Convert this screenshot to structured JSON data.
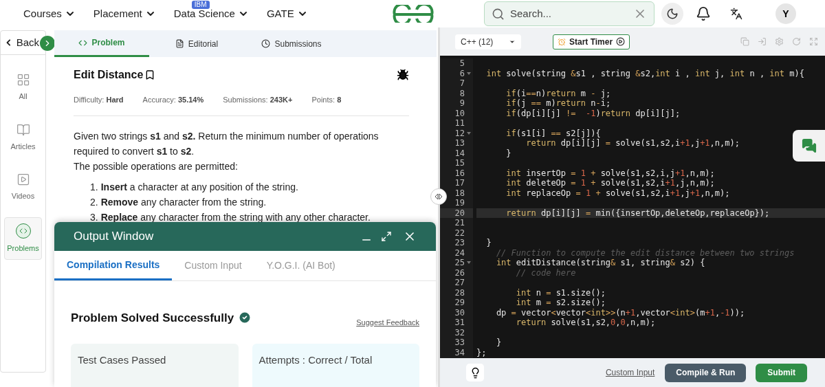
{
  "top_nav": {
    "items": [
      {
        "label": "Courses"
      },
      {
        "label": "Placement"
      },
      {
        "label": "Data Science",
        "badge": "IBM"
      },
      {
        "label": "GATE"
      }
    ],
    "search": {
      "placeholder": "Search..."
    },
    "avatar": "Y"
  },
  "sidebar": {
    "back": "Back",
    "items": [
      {
        "label": "All",
        "selected": false
      },
      {
        "label": "Articles",
        "selected": false
      },
      {
        "label": "Videos",
        "selected": false
      },
      {
        "label": "Problems",
        "selected": true
      }
    ]
  },
  "problem_tabs": [
    {
      "label": "Problem",
      "selected": true
    },
    {
      "label": "Editorial",
      "selected": false
    },
    {
      "label": "Submissions",
      "selected": false
    }
  ],
  "problem": {
    "title": "Edit Distance",
    "meta": [
      {
        "label": "Difficulty:",
        "value": "Hard"
      },
      {
        "label": "Accuracy:",
        "value": "35.14%"
      },
      {
        "label": "Submissions:",
        "value": "243K+"
      },
      {
        "label": "Points:",
        "value": "8"
      }
    ],
    "paragraphs": [
      "Given two strings **s1** and **s2.** Return the minimum number of operations required to convert **s1** to **s2**.",
      "The possible operations are permitted:"
    ],
    "operations": [
      {
        "number": "1.",
        "text": "**Insert** a character at any position of the string."
      },
      {
        "number": "2.",
        "text": "**Remove** any character from the string."
      },
      {
        "number": "3.",
        "text": "**Replace** any character from the string with any other character."
      }
    ]
  },
  "output_window": {
    "title": "Output Window",
    "tabs": [
      {
        "label": "Compilation Results",
        "selected": true
      },
      {
        "label": "Custom Input",
        "selected": false
      },
      {
        "label": "Y.O.G.I. (AI Bot)",
        "selected": false
      }
    ],
    "result": "Problem Solved Successfully",
    "feedback_link": "Suggest Feedback",
    "cards": [
      {
        "label": "Test Cases Passed"
      },
      {
        "label": "Attempts : Correct / Total"
      }
    ]
  },
  "editor": {
    "language": "C++ (12)",
    "timer_button": "Start Timer",
    "lines": [
      {
        "number": "5",
        "active": false,
        "fold": false
      },
      {
        "number": "6",
        "active": false,
        "fold": true,
        "tokens": [
          {
            "kind": "keyword",
            "text": "  int"
          },
          {
            "kind": "plain",
            "text": " solve(string "
          },
          {
            "kind": "op",
            "text": "&"
          },
          {
            "kind": "plain",
            "text": "s1 , string "
          },
          {
            "kind": "op",
            "text": "&"
          },
          {
            "kind": "plain",
            "text": "s2,"
          },
          {
            "kind": "keyword",
            "text": "int"
          },
          {
            "kind": "plain",
            "text": " i , "
          },
          {
            "kind": "keyword",
            "text": "int"
          },
          {
            "kind": "plain",
            "text": " j, "
          },
          {
            "kind": "keyword",
            "text": "int"
          },
          {
            "kind": "plain",
            "text": " n , "
          },
          {
            "kind": "keyword",
            "text": "int"
          },
          {
            "kind": "plain",
            "text": " m){"
          }
        ]
      },
      {
        "number": "7",
        "active": false,
        "fold": false
      },
      {
        "number": "8",
        "active": false,
        "fold": false,
        "tokens": [
          {
            "kind": "keyword",
            "text": "      if"
          },
          {
            "kind": "plain",
            "text": "(i"
          },
          {
            "kind": "op",
            "text": "=="
          },
          {
            "kind": "plain",
            "text": "n)"
          },
          {
            "kind": "keyword",
            "text": "return"
          },
          {
            "kind": "plain",
            "text": " m "
          },
          {
            "kind": "op",
            "text": "-"
          },
          {
            "kind": "plain",
            "text": " j;"
          }
        ]
      },
      {
        "number": "9",
        "active": false,
        "fold": false,
        "tokens": [
          {
            "kind": "keyword",
            "text": "      if"
          },
          {
            "kind": "plain",
            "text": "(j "
          },
          {
            "kind": "op",
            "text": "=="
          },
          {
            "kind": "plain",
            "text": " m)"
          },
          {
            "kind": "keyword",
            "text": "return"
          },
          {
            "kind": "plain",
            "text": " n"
          },
          {
            "kind": "op",
            "text": "-"
          },
          {
            "kind": "plain",
            "text": "i;"
          }
        ]
      },
      {
        "number": "10",
        "active": false,
        "fold": false,
        "tokens": [
          {
            "kind": "keyword",
            "text": "      if"
          },
          {
            "kind": "plain",
            "text": "(dp[i][j] "
          },
          {
            "kind": "op",
            "text": "!="
          },
          {
            "kind": "num",
            "text": "  -1"
          },
          {
            "kind": "plain",
            "text": ")"
          },
          {
            "kind": "keyword",
            "text": "return"
          },
          {
            "kind": "plain",
            "text": " dp[i][j];"
          }
        ]
      },
      {
        "number": "11",
        "active": false,
        "fold": false
      },
      {
        "number": "12",
        "active": false,
        "fold": true,
        "tokens": [
          {
            "kind": "keyword",
            "text": "      if"
          },
          {
            "kind": "plain",
            "text": "(s1[i] "
          },
          {
            "kind": "op",
            "text": "=="
          },
          {
            "kind": "plain",
            "text": " s2[j]){"
          }
        ]
      },
      {
        "number": "13",
        "active": false,
        "fold": false,
        "tokens": [
          {
            "kind": "keyword",
            "text": "          return"
          },
          {
            "kind": "plain",
            "text": " dp[i][j] "
          },
          {
            "kind": "op",
            "text": "="
          },
          {
            "kind": "plain",
            "text": " solve(s1,s2,i"
          },
          {
            "kind": "num",
            "text": "+1"
          },
          {
            "kind": "plain",
            "text": ",j"
          },
          {
            "kind": "num",
            "text": "+1"
          },
          {
            "kind": "plain",
            "text": ",n,m);"
          }
        ]
      },
      {
        "number": "14",
        "active": false,
        "fold": false,
        "tokens": [
          {
            "kind": "plain",
            "text": "      }"
          }
        ]
      },
      {
        "number": "15",
        "active": false,
        "fold": false
      },
      {
        "number": "16",
        "active": false,
        "fold": false,
        "tokens": [
          {
            "kind": "keyword",
            "text": "      int"
          },
          {
            "kind": "plain",
            "text": " insertOp "
          },
          {
            "kind": "op",
            "text": "="
          },
          {
            "kind": "num",
            "text": " 1"
          },
          {
            "kind": "op",
            "text": " +"
          },
          {
            "kind": "plain",
            "text": " solve(s1,s2,i,j"
          },
          {
            "kind": "num",
            "text": "+1"
          },
          {
            "kind": "plain",
            "text": ",n,m);"
          }
        ]
      },
      {
        "number": "17",
        "active": false,
        "fold": false,
        "tokens": [
          {
            "kind": "keyword",
            "text": "      int"
          },
          {
            "kind": "plain",
            "text": " deleteOp "
          },
          {
            "kind": "op",
            "text": "="
          },
          {
            "kind": "num",
            "text": " 1"
          },
          {
            "kind": "op",
            "text": " +"
          },
          {
            "kind": "plain",
            "text": " solve(s1,s2,i"
          },
          {
            "kind": "num",
            "text": "+1"
          },
          {
            "kind": "plain",
            "text": ",j,n,m);"
          }
        ]
      },
      {
        "number": "18",
        "active": false,
        "fold": false,
        "tokens": [
          {
            "kind": "keyword",
            "text": "      int"
          },
          {
            "kind": "plain",
            "text": " replaceOp "
          },
          {
            "kind": "op",
            "text": "="
          },
          {
            "kind": "num",
            "text": " 1"
          },
          {
            "kind": "op",
            "text": " +"
          },
          {
            "kind": "plain",
            "text": " solve(s1,s2,i"
          },
          {
            "kind": "num",
            "text": "+1"
          },
          {
            "kind": "plain",
            "text": ",j"
          },
          {
            "kind": "num",
            "text": "+1"
          },
          {
            "kind": "plain",
            "text": ",n,m);"
          }
        ]
      },
      {
        "number": "19",
        "active": false,
        "fold": false
      },
      {
        "number": "20",
        "active": true,
        "fold": false,
        "tokens": [
          {
            "kind": "keyword",
            "text": "      return"
          },
          {
            "kind": "plain",
            "text": " dp[i][j] "
          },
          {
            "kind": "op",
            "text": "="
          },
          {
            "kind": "plain",
            "text": " min({insertOp,deleteOp,replaceOp});"
          }
        ]
      },
      {
        "number": "21",
        "active": false,
        "fold": false
      },
      {
        "number": "22",
        "active": false,
        "fold": false
      },
      {
        "number": "23",
        "active": false,
        "fold": false,
        "tokens": [
          {
            "kind": "plain",
            "text": "  }"
          }
        ]
      },
      {
        "number": "24",
        "active": false,
        "fold": false,
        "tokens": [
          {
            "kind": "comment",
            "text": "    // Function to compute the edit distance between two strings"
          }
        ]
      },
      {
        "number": "25",
        "active": false,
        "fold": true,
        "tokens": [
          {
            "kind": "keyword",
            "text": "    int"
          },
          {
            "kind": "plain",
            "text": " editDistance(string"
          },
          {
            "kind": "op",
            "text": "&"
          },
          {
            "kind": "plain",
            "text": " s1, string"
          },
          {
            "kind": "op",
            "text": "&"
          },
          {
            "kind": "plain",
            "text": " s2) {"
          }
        ]
      },
      {
        "number": "26",
        "active": false,
        "fold": false,
        "tokens": [
          {
            "kind": "comment",
            "text": "        // code here"
          }
        ]
      },
      {
        "number": "27",
        "active": false,
        "fold": false
      },
      {
        "number": "28",
        "active": false,
        "fold": false,
        "tokens": [
          {
            "kind": "keyword",
            "text": "        int"
          },
          {
            "kind": "plain",
            "text": " n "
          },
          {
            "kind": "op",
            "text": "="
          },
          {
            "kind": "plain",
            "text": " s1.size();"
          }
        ]
      },
      {
        "number": "29",
        "active": false,
        "fold": false,
        "tokens": [
          {
            "kind": "keyword",
            "text": "        int"
          },
          {
            "kind": "plain",
            "text": " m "
          },
          {
            "kind": "op",
            "text": "="
          },
          {
            "kind": "plain",
            "text": " s2.size();"
          }
        ]
      },
      {
        "number": "30",
        "active": false,
        "fold": false,
        "tokens": [
          {
            "kind": "plain",
            "text": "    dp "
          },
          {
            "kind": "op",
            "text": "="
          },
          {
            "kind": "plain",
            "text": " vector"
          },
          {
            "kind": "op",
            "text": "<"
          },
          {
            "kind": "plain",
            "text": "vector"
          },
          {
            "kind": "op",
            "text": "<"
          },
          {
            "kind": "keyword",
            "text": "int"
          },
          {
            "kind": "op",
            "text": ">>"
          },
          {
            "kind": "plain",
            "text": "(n"
          },
          {
            "kind": "num",
            "text": "+1"
          },
          {
            "kind": "plain",
            "text": ",vector"
          },
          {
            "kind": "op",
            "text": "<"
          },
          {
            "kind": "keyword",
            "text": "int"
          },
          {
            "kind": "op",
            "text": ">"
          },
          {
            "kind": "plain",
            "text": "(m"
          },
          {
            "kind": "num",
            "text": "+1"
          },
          {
            "kind": "plain",
            "text": ","
          },
          {
            "kind": "num",
            "text": "-1"
          },
          {
            "kind": "plain",
            "text": "));"
          }
        ]
      },
      {
        "number": "31",
        "active": false,
        "fold": false,
        "tokens": [
          {
            "kind": "keyword",
            "text": "        return"
          },
          {
            "kind": "plain",
            "text": " solve(s1,s2,"
          },
          {
            "kind": "num",
            "text": "0"
          },
          {
            "kind": "plain",
            "text": ","
          },
          {
            "kind": "num",
            "text": "0"
          },
          {
            "kind": "plain",
            "text": ",n,m);"
          }
        ]
      },
      {
        "number": "32",
        "active": false,
        "fold": false
      },
      {
        "number": "33",
        "active": false,
        "fold": false,
        "tokens": [
          {
            "kind": "plain",
            "text": "    }"
          }
        ]
      },
      {
        "number": "34",
        "active": false,
        "fold": false,
        "tokens": [
          {
            "kind": "plain",
            "text": "};"
          }
        ]
      }
    ],
    "custom_input_link": "Custom Input",
    "compile_button": "Compile & Run",
    "submit_button": "Submit"
  }
}
